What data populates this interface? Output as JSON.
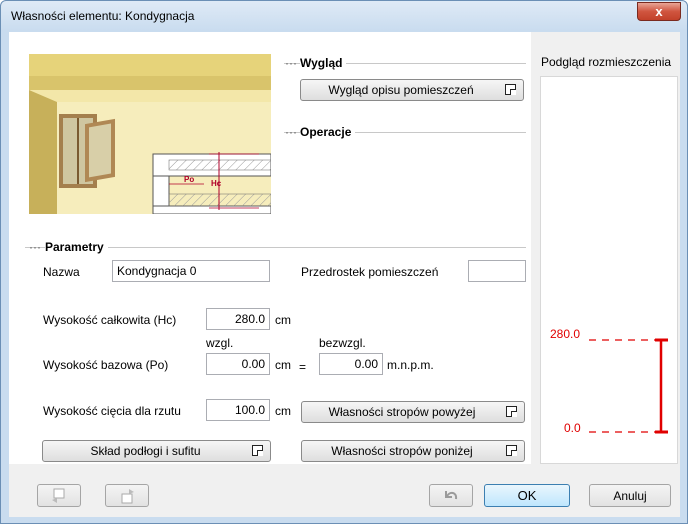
{
  "window": {
    "title": "Własności elementu: Kondygnacja",
    "close_label": "x"
  },
  "appearance": {
    "section_title": "Wygląd",
    "room_desc_button": "Wygląd opisu pomieszczeń"
  },
  "operations": {
    "section_title": "Operacje"
  },
  "illustration": {
    "hc_label": "Hc",
    "po_label": "Po"
  },
  "parameters": {
    "section_title": "Parametry",
    "name_label": "Nazwa",
    "name_value": "Kondygnacja 0",
    "prefix_label": "Przedrostek pomieszczeń",
    "prefix_value": "",
    "total_height_label": "Wysokość całkowita (Hc)",
    "total_height_value": "280.0",
    "total_height_unit": "cm",
    "relative_label": "wzgl.",
    "absolute_label": "bezwzgl.",
    "base_height_label": "Wysokość bazowa (Po)",
    "base_height_rel_value": "0.00",
    "base_height_rel_unit": "cm",
    "equals_sign": "=",
    "base_height_abs_value": "0.00",
    "base_height_abs_unit": "m.n.p.m.",
    "cut_height_label": "Wysokość cięcia dla rzutu",
    "cut_height_value": "100.0",
    "cut_height_unit": "cm",
    "floor_ceiling_button": "Skład podłogi i sufitu",
    "ceilings_above_button": "Własności stropów powyżej",
    "ceilings_below_button": "Własności stropów poniżej"
  },
  "preview": {
    "title": "Podgląd rozmieszczenia",
    "top_value": "280.0",
    "bottom_value": "0.0",
    "marker_color": "#e00000"
  },
  "footer": {
    "ok_label": "OK",
    "cancel_label": "Anuluj"
  }
}
